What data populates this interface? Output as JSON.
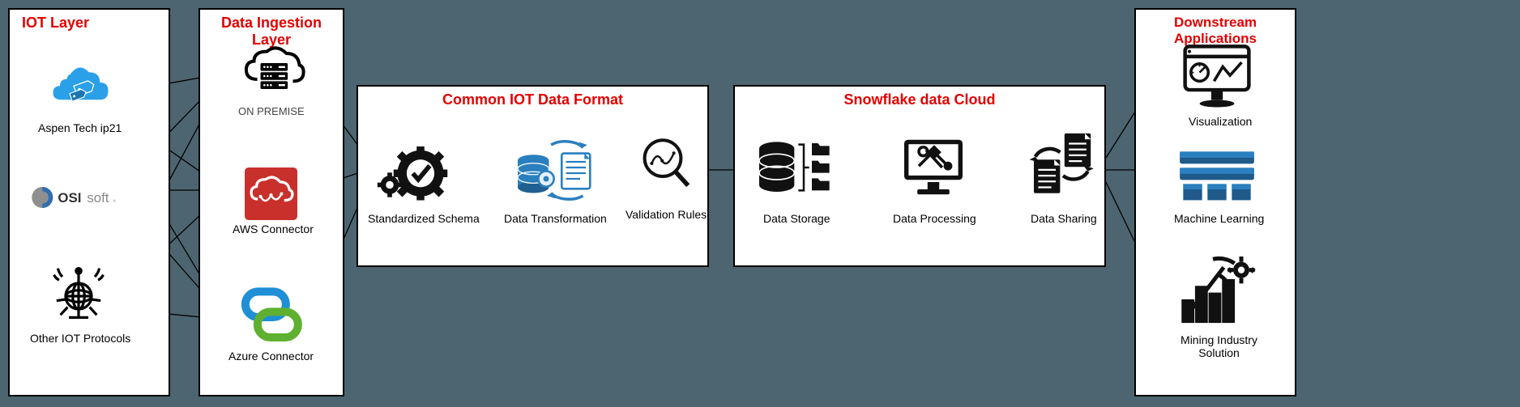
{
  "layers": {
    "iot": {
      "title": "IOT Layer",
      "items": {
        "aspen": "Aspen Tech ip21",
        "osisoft": "OSIsoft",
        "other": "Other IOT Protocols"
      }
    },
    "ingestion": {
      "title": "Data Ingestion  Layer",
      "items": {
        "onprem": "ON PREMISE",
        "aws": "AWS Connector",
        "azure": "Azure Connector"
      }
    },
    "common": {
      "title": "Common IOT Data Format",
      "items": {
        "schema": "Standardized Schema",
        "transform": "Data Transformation",
        "validate": "Validation Rules"
      }
    },
    "snowflake": {
      "title": "Snowflake data Cloud",
      "items": {
        "storage": "Data Storage",
        "processing": "Data Processing",
        "sharing": "Data Sharing"
      }
    },
    "downstream": {
      "title": "Downstream Applications",
      "items": {
        "viz": "Visualization",
        "ml": "Machine Learning",
        "mining": "Mining Industry Solution"
      }
    }
  }
}
